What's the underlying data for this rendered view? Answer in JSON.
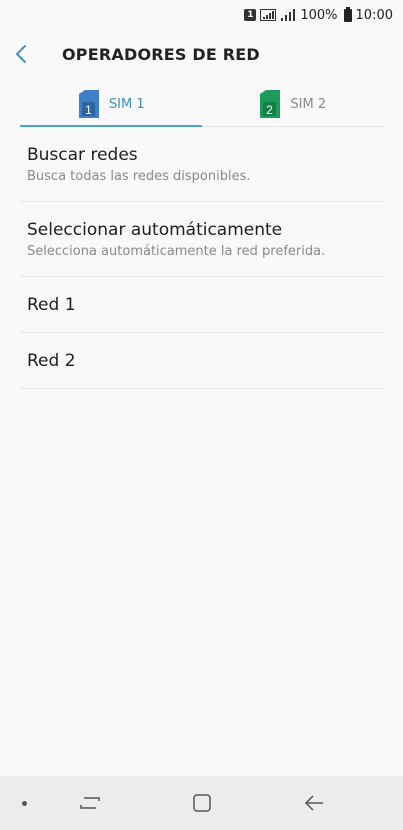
{
  "status_bar": {
    "sim_indicator": "1",
    "battery": "100%",
    "time": "10:00",
    "icons": [
      "sim-1-icon",
      "signal-strength-icon",
      "signal-bars-icon",
      "battery-icon"
    ]
  },
  "header": {
    "title": "OPERADORES DE RED",
    "back_icon": "back-chevron-icon"
  },
  "tabs": [
    {
      "label": "SIM 1",
      "sim_number": "1",
      "active": true,
      "color": "#3f7fc6"
    },
    {
      "label": "SIM 2",
      "sim_number": "2",
      "active": false,
      "color": "#1e9a5a"
    }
  ],
  "list": {
    "items": [
      {
        "title": "Buscar redes",
        "subtitle": "Busca todas las redes disponibles."
      },
      {
        "title": "Seleccionar automáticamente",
        "subtitle": "Selecciona automáticamente la red preferida."
      },
      {
        "title": "Red 1"
      },
      {
        "title": "Red 2"
      }
    ]
  },
  "nav_bar": {
    "icons": [
      "dot-icon",
      "recent-apps-icon",
      "home-icon",
      "back-arrow-icon"
    ]
  },
  "colors": {
    "accent": "#3e8fc5",
    "sim1": "#3f7fc6",
    "sim2": "#1e9a5a",
    "background": "#f9f9f9"
  }
}
